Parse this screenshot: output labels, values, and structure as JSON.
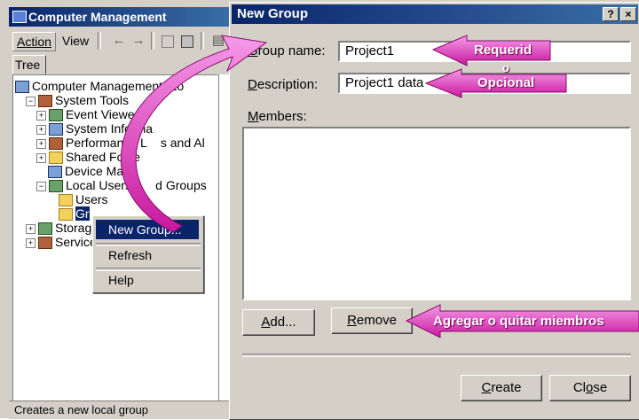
{
  "background_window": {
    "title": "Computer Management",
    "menu": {
      "action": "Action",
      "view": "View"
    },
    "tab": "Tree",
    "tree": [
      {
        "label": "Computer Management (Lo",
        "indent": 0,
        "expander": "",
        "icon": "computer-management-icon"
      },
      {
        "label": "System Tools",
        "indent": 1,
        "expander": "−",
        "icon": "system-tools-icon"
      },
      {
        "label": "Event Viewer",
        "indent": 2,
        "expander": "+",
        "icon": "event-viewer-icon"
      },
      {
        "label": "System Informa",
        "indent": 2,
        "expander": "+",
        "icon": "system-information-icon"
      },
      {
        "label": "Performance L    s and Al",
        "indent": 2,
        "expander": "+",
        "icon": "performance-logs-icon"
      },
      {
        "label": "Shared Folde",
        "indent": 2,
        "expander": "+",
        "icon": "shared-folders-icon"
      },
      {
        "label": "Device Mana",
        "indent": 2,
        "expander": "",
        "icon": "device-manager-icon"
      },
      {
        "label": "Local Users a    d Groups",
        "indent": 2,
        "expander": "−",
        "icon": "local-users-groups-icon"
      },
      {
        "label": "Users",
        "indent": 3,
        "expander": "",
        "icon": "folder-icon"
      },
      {
        "label": "Gr",
        "indent": 3,
        "expander": "",
        "icon": "folder-open-icon",
        "selected": true
      },
      {
        "label": "Storage",
        "indent": 1,
        "expander": "+",
        "icon": "storage-icon"
      },
      {
        "label": "Services",
        "indent": 1,
        "expander": "+",
        "icon": "services-icon"
      }
    ],
    "status": "Creates a new local group"
  },
  "context_menu": {
    "items": [
      "New Group...",
      "Refresh",
      "Help"
    ]
  },
  "dialog": {
    "title": "New Group",
    "help_btn": "?",
    "close_btn": "×",
    "group_name_label": {
      "acc": "G",
      "rest": "roup name:"
    },
    "group_name_value": "Project1",
    "description_label": {
      "acc": "D",
      "rest": "escription:"
    },
    "description_value": "Project1 data",
    "members_label": {
      "acc": "M",
      "rest": "embers:"
    },
    "add_btn": {
      "acc": "A",
      "rest": "dd..."
    },
    "remove_btn": {
      "acc": "R",
      "rest": "emove"
    },
    "create_btn": {
      "acc": "C",
      "rest": "reate"
    },
    "close_btn_label": {
      "pre": "Cl",
      "acc": "o",
      "rest": "se"
    }
  },
  "callouts": {
    "required": "Requerid",
    "required_o": "o",
    "optional": "Opcional",
    "members": "Agregar o quitar miembros",
    "arrow_color": "#e040c8"
  }
}
